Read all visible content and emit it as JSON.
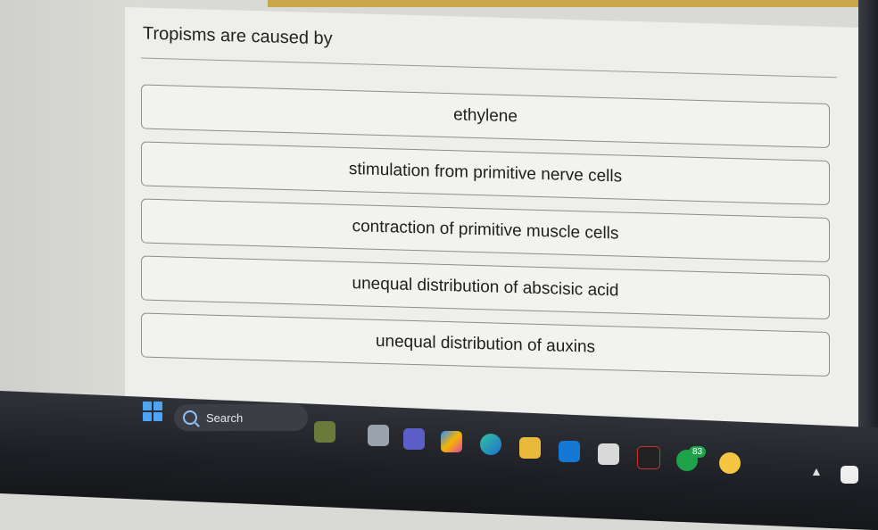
{
  "question": {
    "text": "Tropisms are caused by"
  },
  "options": [
    {
      "label": "ethylene"
    },
    {
      "label": "stimulation from primitive nerve cells"
    },
    {
      "label": "contraction of primitive muscle cells"
    },
    {
      "label": "unequal distribution of abscisic acid"
    },
    {
      "label": "unequal distribution of auxins"
    }
  ],
  "taskbar": {
    "search_label": "Search",
    "badge_count": "83",
    "icons": [
      "windows-start-icon",
      "search-icon",
      "widgets-icon",
      "file-explorer-icon",
      "teams-icon",
      "copilot-icon",
      "edge-icon",
      "folder-icon",
      "outlook-icon",
      "store-icon",
      "media-icon",
      "chrome-icon",
      "user-icon",
      "tray-chevron-icon",
      "tray-app-icon"
    ]
  },
  "colors": {
    "accent_top": "#c9a84a",
    "taskbar": "#1d1f24",
    "windows_blue": "#4ea4f5"
  }
}
